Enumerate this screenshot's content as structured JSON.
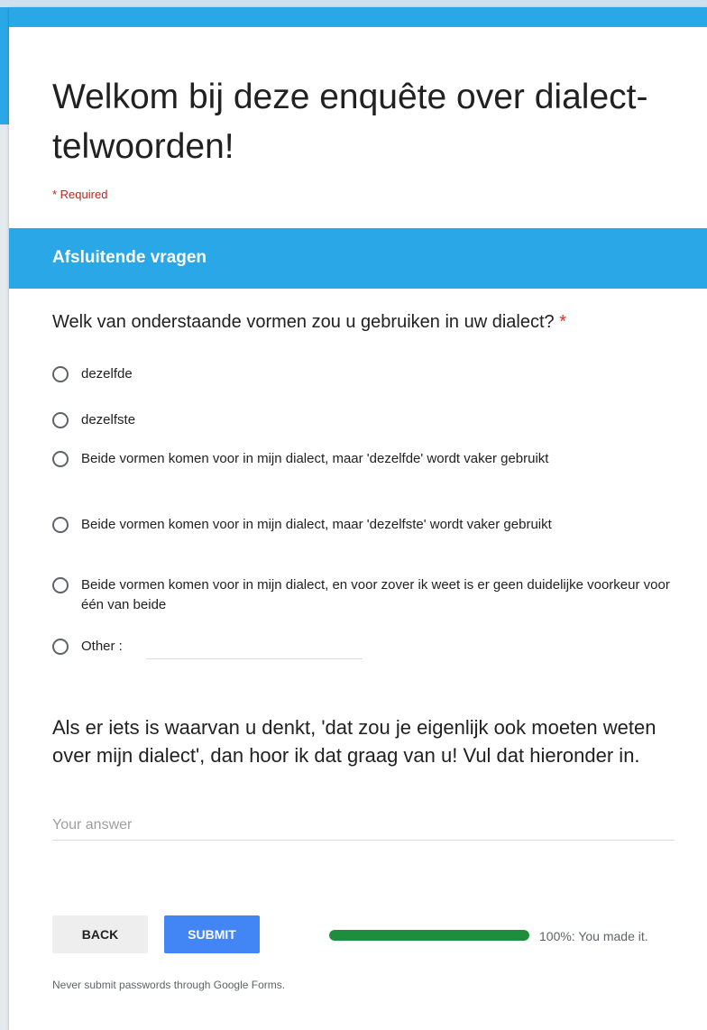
{
  "form": {
    "title": "Welkom bij deze enquête over dialect-telwoorden!",
    "required_note": "* Required"
  },
  "section": {
    "title": "Afsluitende vragen"
  },
  "question1": {
    "text": "Welk van onderstaande vormen zou u gebruiken in uw dialect?",
    "required_mark": "*",
    "options": [
      {
        "label": "dezelfde"
      },
      {
        "label": "dezelfste"
      },
      {
        "label": "Beide vormen komen voor in mijn dialect, maar 'dezelfde' wordt vaker gebruikt"
      },
      {
        "label": "Beide vormen komen voor in mijn dialect, maar 'dezelfste' wordt vaker gebruikt"
      },
      {
        "label": "Beide vormen komen voor in mijn dialect, en voor zover ik weet is er geen duidelijke voorkeur voor één van beide"
      },
      {
        "label": "Other :"
      }
    ],
    "other_value": ""
  },
  "question2": {
    "text": "Als er iets is waarvan u denkt, 'dat zou je eigenlijk ook moeten weten over mijn dialect', dan hoor ik dat graag van u! Vul dat hieronder in.",
    "placeholder": "Your answer"
  },
  "nav": {
    "back_label": "BACK",
    "submit_label": "SUBMIT"
  },
  "progress": {
    "percent": 100,
    "text": "100%: You made it."
  },
  "footer": {
    "note": "Never submit passwords through Google Forms."
  },
  "colors": {
    "accent": "#2aa7e7",
    "submit": "#4285f4",
    "progress": "#1e8e3e",
    "required": "#d93025"
  }
}
